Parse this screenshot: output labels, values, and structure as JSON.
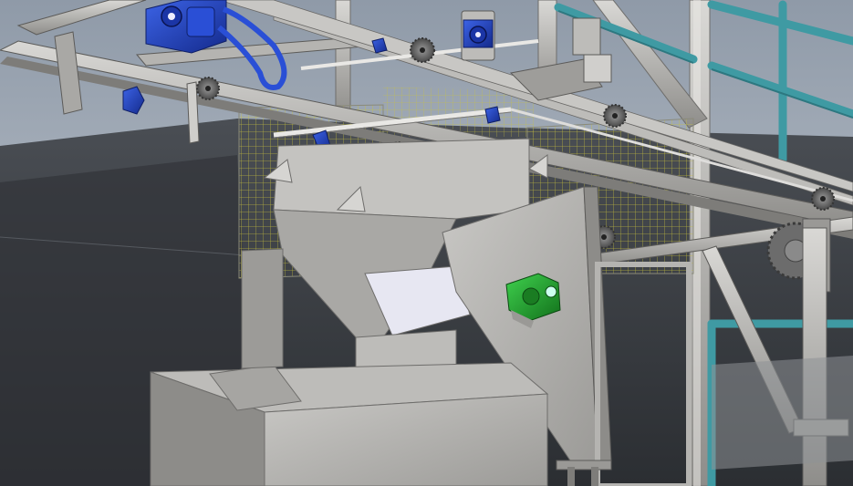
{
  "scene": {
    "kind": "cad-3d-render",
    "colors": {
      "sky_top": "#8f9aa8",
      "sky_bottom": "#c9cfd6",
      "floor": "#3a3d42",
      "steel_light": "#d4d3d0",
      "steel_mid": "#a9a8a5",
      "steel_dark": "#6e6d6b",
      "motor_blue": "#1f3fbf",
      "bearing_green": "#1e9a2a",
      "railing_teal": "#3f9aa3",
      "mesh_yellow": "#c9c23c"
    },
    "components": [
      "gear-motor",
      "chain-drive",
      "sprockets",
      "conveyor-frame",
      "feed-hopper",
      "side-plate",
      "bearing-unit",
      "guard-mesh",
      "safety-railing",
      "support-columns",
      "base-enclosure"
    ]
  }
}
